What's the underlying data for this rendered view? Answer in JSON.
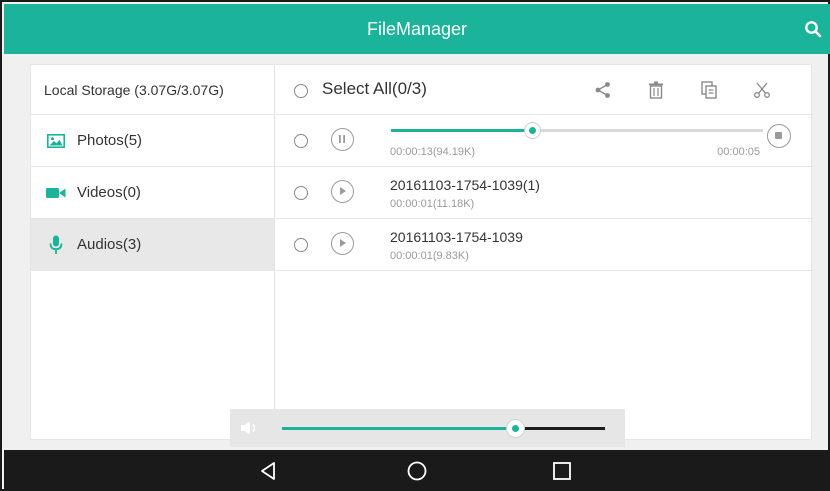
{
  "app": {
    "title": "FileManager"
  },
  "sidebar": {
    "header": "Local Storage (3.07G/3.07G)",
    "items": [
      {
        "label": "Photos(5)",
        "icon": "image-icon"
      },
      {
        "label": "Videos(0)",
        "icon": "video-camera-icon"
      },
      {
        "label": "Audios(3)",
        "icon": "microphone-icon",
        "active": true
      }
    ]
  },
  "toolbar": {
    "select_all_label": "Select All(0/3)",
    "actions": [
      "share-icon",
      "delete-icon",
      "copy-icon",
      "cut-icon"
    ]
  },
  "files": [
    {
      "state": "playing",
      "elapsed": "00:00:13(94.19K)",
      "duration": "00:00:05",
      "progress": 0.38
    },
    {
      "name": "20161103-1754-1039(1)",
      "meta": "00:00:01(11.18K)"
    },
    {
      "name": "20161103-1754-1039",
      "meta": "00:00:01(9.83K)"
    }
  ],
  "volume": {
    "level": 0.72
  },
  "colors": {
    "accent": "#1bb39a",
    "titlebar": "#1bb39a",
    "navbar": "#1a1a1a"
  }
}
